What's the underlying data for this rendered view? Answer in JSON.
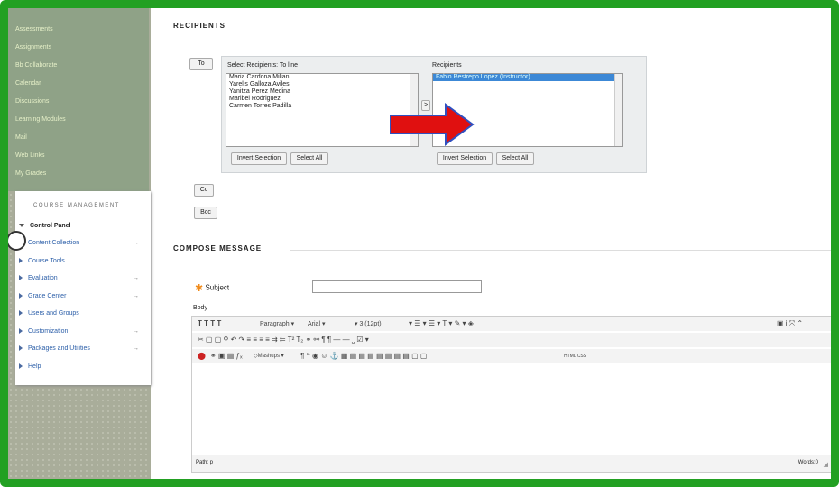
{
  "sidebar": {
    "nav": [
      "Assessments",
      "Assignments",
      "Bb Collaborate",
      "Calendar",
      "Discussions",
      "Learning Modules",
      "Mail",
      "Web Links",
      "My Grades"
    ],
    "management_title": "COURSE MANAGEMENT",
    "control_panel": "Control Panel",
    "items": [
      "Content Collection",
      "Course Tools",
      "Evaluation",
      "Grade Center",
      "Users and Groups",
      "Customization",
      "Packages and Utilities",
      "Help"
    ]
  },
  "recipients": {
    "heading": "RECIPIENTS",
    "to_button": "To",
    "select_label": "Select Recipients: To line",
    "available": [
      "Maria Cardona Milian",
      "Yarelis Galloza Aviles",
      "Yanitza Perez Medina",
      "Maribel Rodriguez",
      "Carmen Torres Padilla"
    ],
    "recipients_label": "Recipients",
    "selected": [
      "Fabio Restrepo Lopez (Instructor)"
    ],
    "invert_label": "Invert Selection",
    "select_all_label": "Select All",
    "move_button": ">",
    "cc_button": "Cc",
    "bcc_button": "Bcc"
  },
  "compose": {
    "heading": "COMPOSE MESSAGE",
    "subject_label": "Subject",
    "subject_value": "",
    "body_label": "Body",
    "paragraph": "Paragraph",
    "font": "Arial",
    "size": "3 (12pt)",
    "mashups": "Mashups",
    "html_css": "HTML CSS",
    "path_label": "Path: p",
    "words_label": "Words:0"
  },
  "colors": {
    "frame": "#22a022",
    "arrow": "#e01010",
    "nav_bg": "#8fa287",
    "link": "#2b5ea8"
  }
}
